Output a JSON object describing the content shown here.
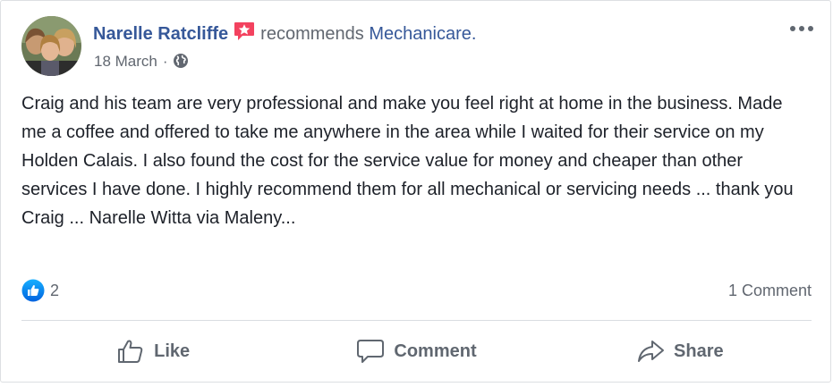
{
  "post": {
    "author": "Narelle Ratcliffe",
    "action_text": "recommends",
    "page_name": "Mechanicare.",
    "date": "18 March",
    "separator": "·",
    "privacy_icon": "globe-icon",
    "body": "Craig and his team are very professional and make you feel right at home in the business. Made me a coffee and offered to take me anywhere in the area while I waited for their service on my Holden Calais. I also found the cost for the service value for money and cheaper than other services I have done. I highly recommend them for all mechanical or servicing needs ... thank you Craig ... Narelle Witta via Maleny..."
  },
  "stats": {
    "reaction_icon": "like-reaction-icon",
    "reaction_count": "2",
    "comment_count": "1 Comment"
  },
  "actions": {
    "like_label": "Like",
    "comment_label": "Comment",
    "share_label": "Share"
  },
  "colors": {
    "link_blue": "#365899",
    "recommend_badge": "#f3425f",
    "like_blue": "#1877f2",
    "muted_text": "#616770",
    "body_text": "#1d2129"
  }
}
